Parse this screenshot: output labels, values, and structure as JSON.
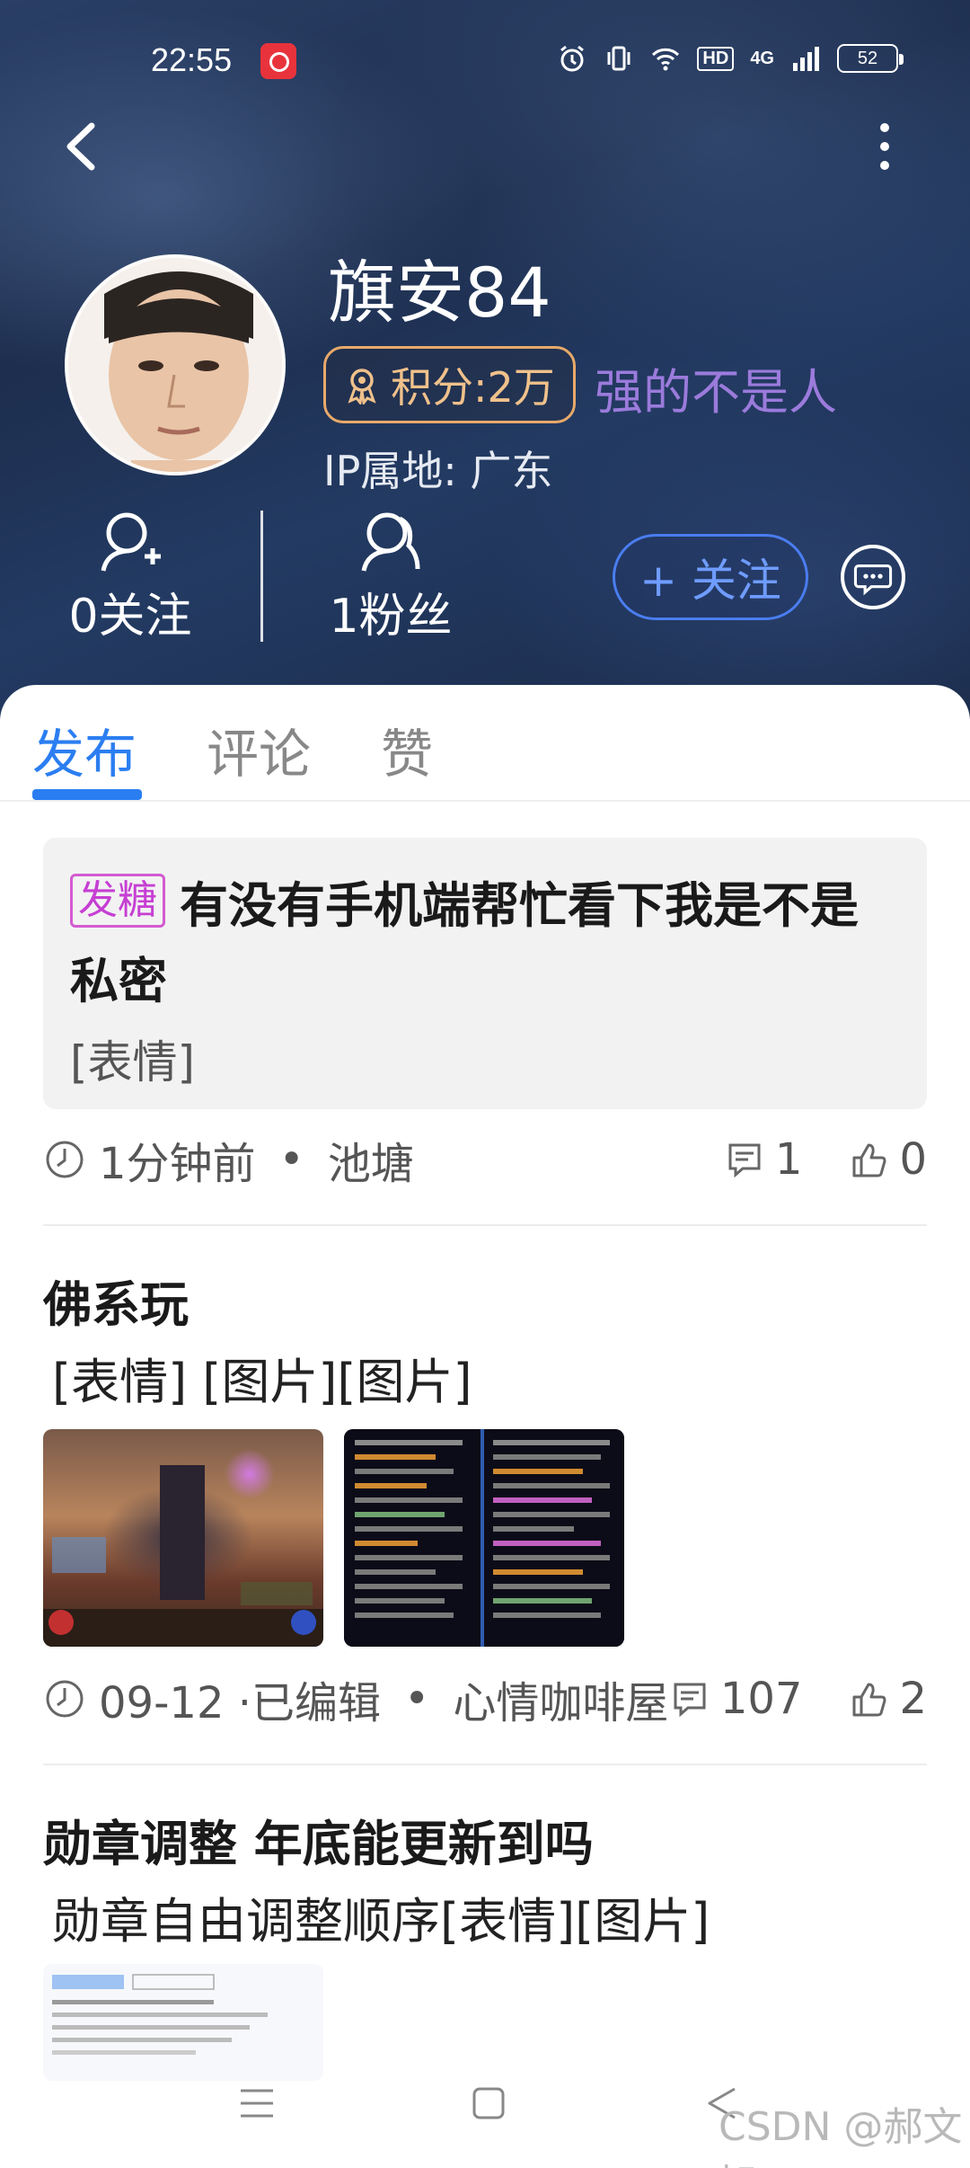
{
  "status_bar": {
    "time": "22:55",
    "network_badge": "HD",
    "signal_label": "4G",
    "battery": "52"
  },
  "header": {
    "username": "旗安84",
    "points_label": "积分:2万",
    "motto": "强的不是人",
    "ip_location": "IP属地: 广东",
    "following_label": "0关注",
    "followers_label": "1粉丝",
    "follow_button": "+ 关注"
  },
  "tabs": [
    {
      "label": "发布",
      "active": true
    },
    {
      "label": "评论",
      "active": false
    },
    {
      "label": "赞",
      "active": false
    }
  ],
  "posts": [
    {
      "tag": "发糖",
      "title": "有没有手机端帮忙看下我是不是私密",
      "body": "[表情]",
      "time": "1分钟前",
      "channel": "池塘",
      "comments": "1",
      "likes": "0"
    },
    {
      "title": "佛系玩",
      "body": "[表情]  [图片][图片]",
      "time": "09-12 ·已编辑",
      "channel": "心情咖啡屋",
      "comments": "107",
      "likes": "2"
    },
    {
      "title": "勋章调整 年底能更新到吗",
      "body": "勋章自由调整顺序[表情][图片]"
    }
  ],
  "watermark": "CSDN @郝文旭",
  "colors": {
    "accent": "#2b7ef1",
    "badge": "#e8a96a",
    "motto": "#9b7bdc",
    "tag": "#c63fd3"
  }
}
